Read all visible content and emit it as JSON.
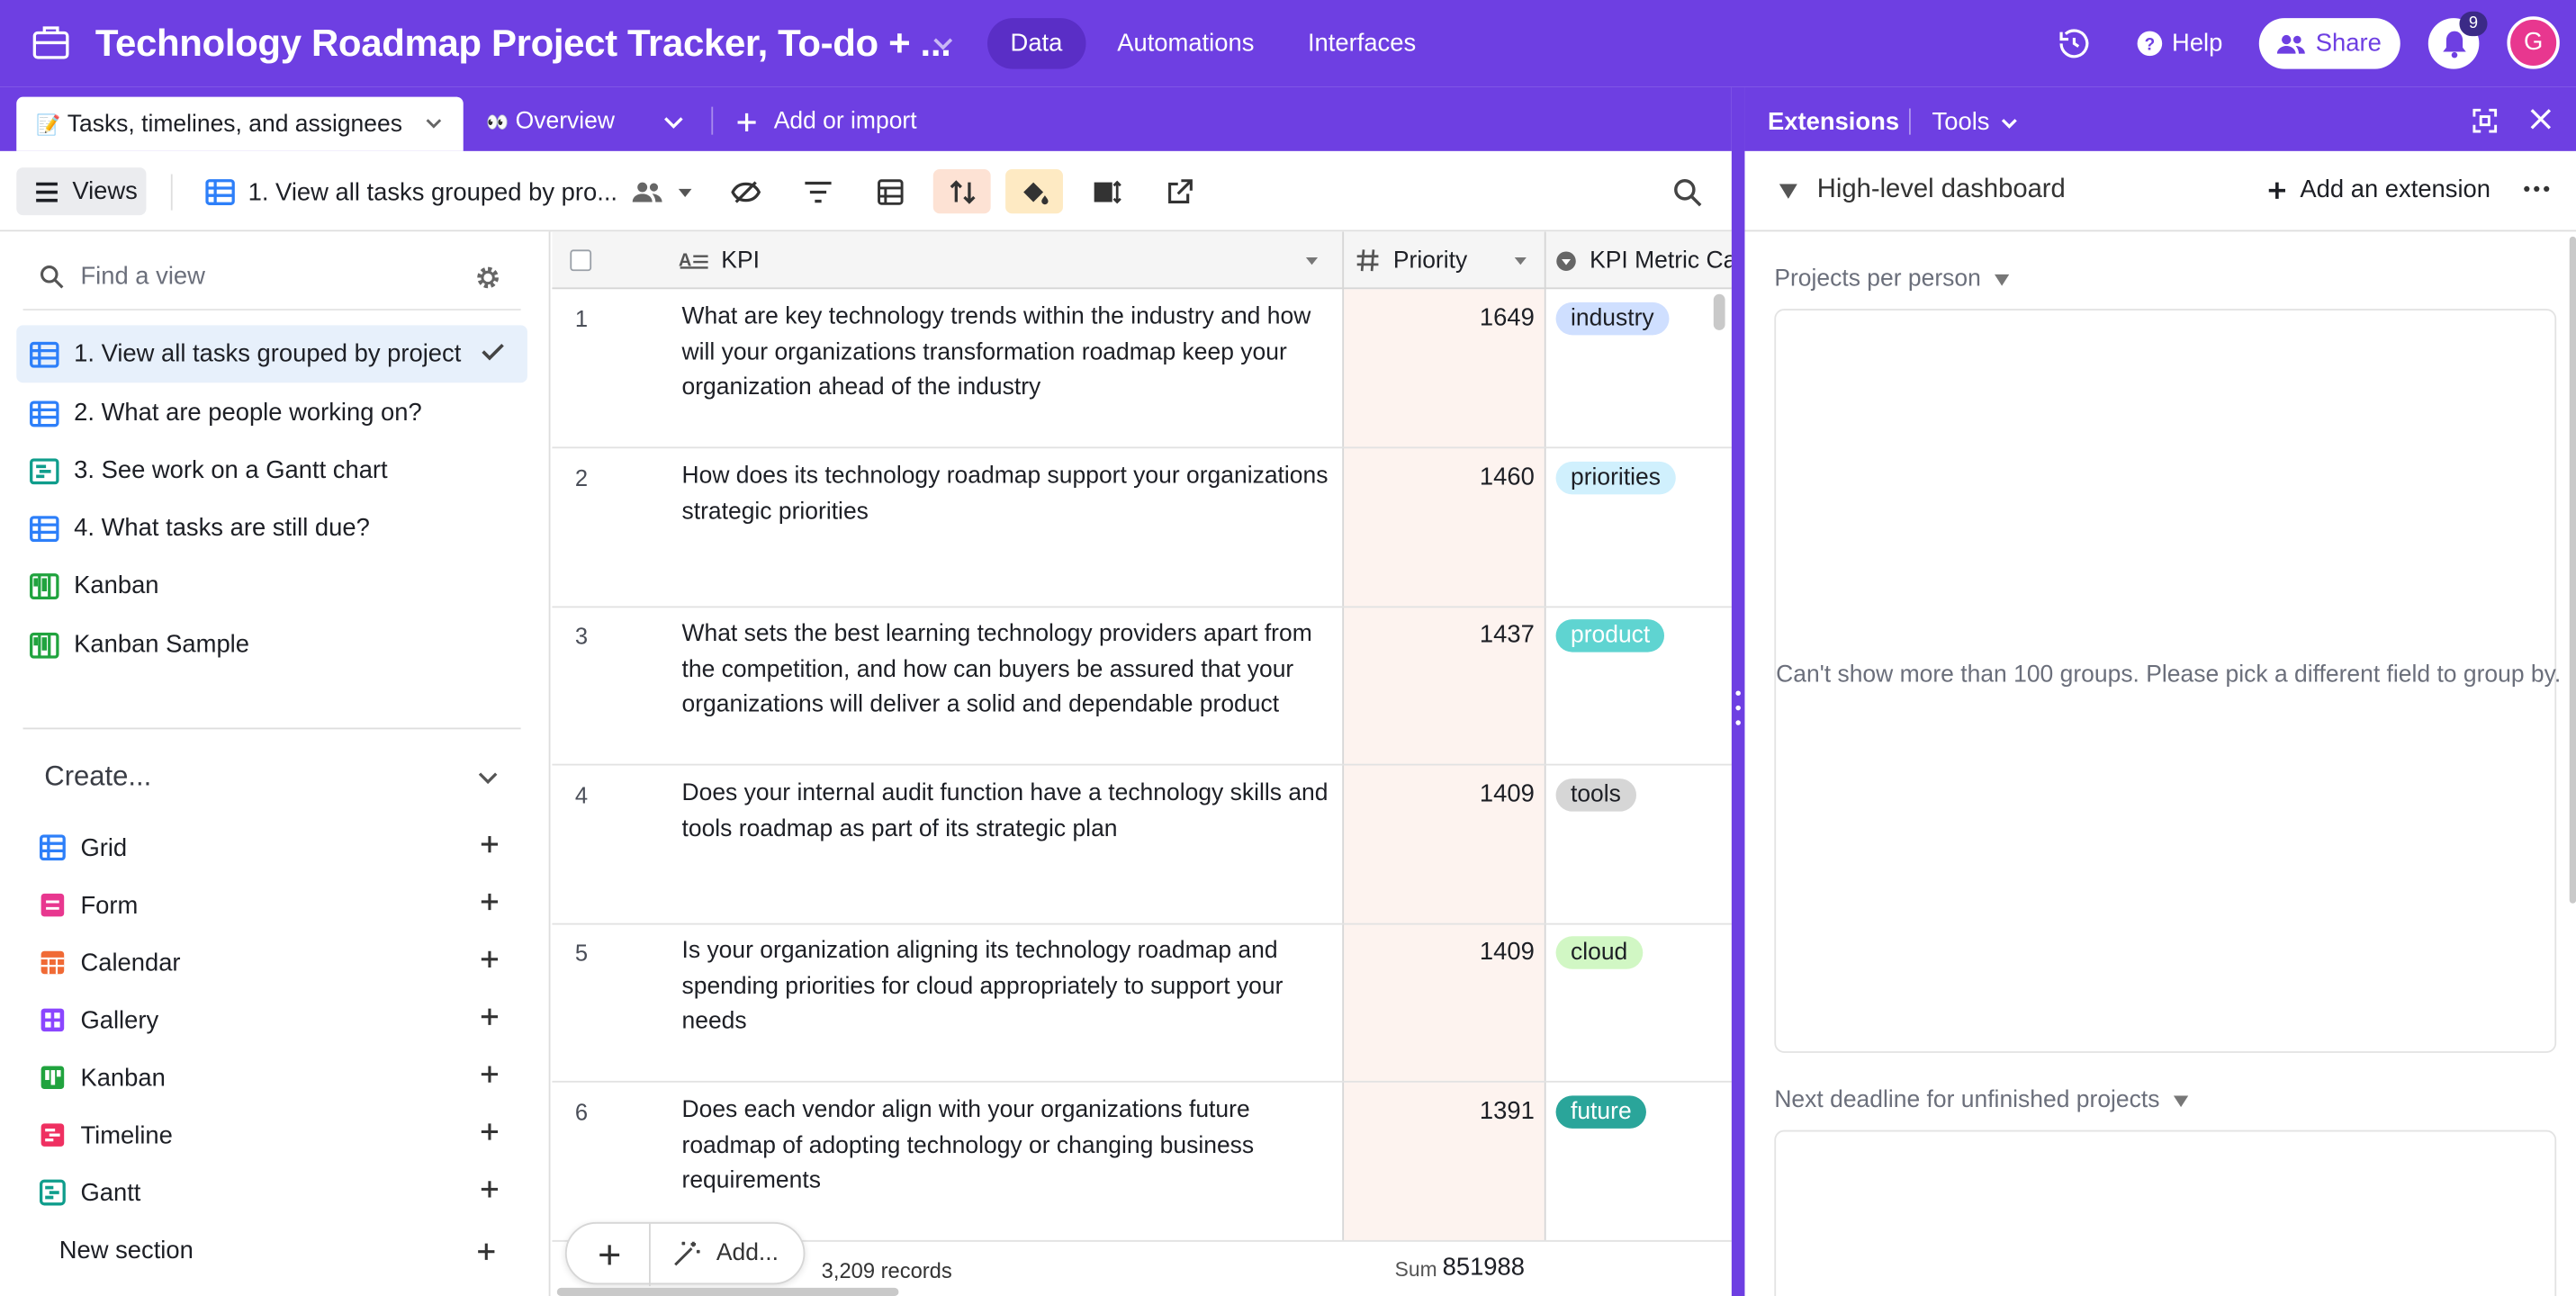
{
  "app": {
    "title": "Technology Roadmap Project Tracker, To-do + ...",
    "nav": [
      "Data",
      "Automations",
      "Interfaces"
    ],
    "help_label": "Help",
    "share_label": "Share",
    "notification_count": "9",
    "avatar_initial": "G",
    "accent_color": "#6e3fe2"
  },
  "tabs": {
    "active_label": "Tasks, timelines, and assignees",
    "overview_label": "Overview",
    "add_import_label": "Add or import"
  },
  "toolbar": {
    "views_label": "Views",
    "current_view": "1. View all tasks grouped by pro..."
  },
  "sidebar": {
    "find_placeholder": "Find a view",
    "views": [
      {
        "label": "1. View all tasks grouped by project",
        "icon": "grid-icon"
      },
      {
        "label": "2. What are people working on?",
        "icon": "grid-icon"
      },
      {
        "label": "3. See work on a Gantt chart",
        "icon": "gantt-icon"
      },
      {
        "label": "4. What tasks are still due?",
        "icon": "grid-icon"
      },
      {
        "label": "Kanban",
        "icon": "kanban-icon"
      },
      {
        "label": "Kanban Sample",
        "icon": "kanban-icon"
      }
    ],
    "create_label": "Create...",
    "create_items": [
      {
        "label": "Grid",
        "color": "#2d7ff9"
      },
      {
        "label": "Form",
        "color": "#e8378f"
      },
      {
        "label": "Calendar",
        "color": "#f06a35"
      },
      {
        "label": "Gallery",
        "color": "#8b46ff"
      },
      {
        "label": "Kanban",
        "color": "#20a33e"
      },
      {
        "label": "Timeline",
        "color": "#ef3061"
      },
      {
        "label": "Gantt",
        "color": "#0f9d8c"
      }
    ],
    "new_section_label": "New section"
  },
  "grid": {
    "columns": [
      "KPI",
      "Priority",
      "KPI Metric Ca"
    ],
    "rows": [
      {
        "num": "1",
        "kpi": "What are key technology trends within the industry and how will your organizations transformation roadmap keep your organization ahead of the industry",
        "priority": "1649",
        "tag": "industry",
        "tag_color": "#cfdfff"
      },
      {
        "num": "2",
        "kpi": "How does its technology roadmap support your organizations strategic priorities",
        "priority": "1460",
        "tag": "priorities",
        "tag_color": "#d0f0fd"
      },
      {
        "num": "3",
        "kpi": "What sets the best learning technology providers apart from the competition, and how can buyers be assured that your organizations will deliver a solid and dependable product",
        "priority": "1437",
        "tag": "product",
        "tag_color": "#5fd4d1",
        "tag_text_color": "#ffffff"
      },
      {
        "num": "4",
        "kpi": "Does your internal audit function have a technology skills and tools roadmap as part of its strategic plan",
        "priority": "1409",
        "tag": "tools",
        "tag_color": "#d6d6d6"
      },
      {
        "num": "5",
        "kpi": "Is your organization aligning its technology roadmap and spending priorities for cloud appropriately to support your needs",
        "priority": "1409",
        "tag": "cloud",
        "tag_color": "#d1f7c4"
      },
      {
        "num": "6",
        "kpi": "Does each vendor align with your organizations future roadmap of adopting technology or changing business requirements",
        "priority": "1391",
        "tag": "future",
        "tag_color": "#2aa59a",
        "tag_text_color": "#ffffff"
      }
    ],
    "add_label": "Add...",
    "records_label": "3,209 records",
    "sum_label": "Sum",
    "sum_value": "851988"
  },
  "extensions": {
    "title": "Extensions",
    "tools_label": "Tools",
    "dashboard_name": "High-level dashboard",
    "add_extension_label": "Add an extension",
    "widgets": [
      {
        "title": "Projects per person",
        "message": "Can't show more than 100 groups. Please pick a different field to group by."
      },
      {
        "title": "Next deadline for unfinished projects",
        "message": ""
      }
    ]
  }
}
